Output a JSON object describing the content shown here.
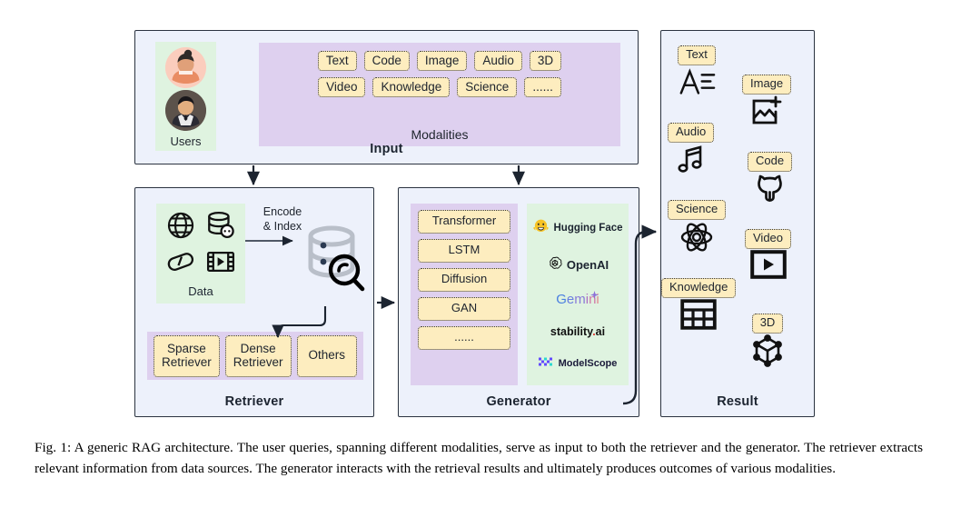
{
  "input": {
    "title": "Input",
    "users_label": "Users",
    "modalities_label": "Modalities",
    "modalities_row1": [
      "Text",
      "Code",
      "Image",
      "Audio",
      "3D"
    ],
    "modalities_row2": [
      "Video",
      "Knowledge",
      "Science",
      "......"
    ]
  },
  "retriever": {
    "title": "Retriever",
    "data_label": "Data",
    "data_icons": [
      "globe-icon",
      "database-icon",
      "capsule-icon",
      "film-icon"
    ],
    "encode_label": "Encode\n& Index",
    "encode_line1": "Encode",
    "encode_line2": "& Index",
    "retrievers": [
      "Sparse Retriever",
      "Dense Retriever",
      "Others"
    ],
    "retriever_lines": [
      [
        "Sparse",
        "Retriever"
      ],
      [
        "Dense",
        "Retriever"
      ],
      [
        "Others",
        ""
      ]
    ]
  },
  "generator": {
    "title": "Generator",
    "architectures": [
      "Transformer",
      "LSTM",
      "Diffusion",
      "GAN",
      "......"
    ],
    "logos": [
      {
        "name": "Hugging Face",
        "icon": "hugging-face-icon"
      },
      {
        "name": "OpenAI",
        "icon": "openai-icon"
      },
      {
        "name": "Gemini",
        "icon": "gemini-sparkle-icon"
      },
      {
        "name": "stability.ai",
        "icon": "stability-icon"
      },
      {
        "name": "ModelScope",
        "icon": "modelscope-icon"
      }
    ]
  },
  "result": {
    "title": "Result",
    "items": [
      {
        "label": "Text",
        "icon": "text-a-lines-icon"
      },
      {
        "label": "Image",
        "icon": "image-plus-icon"
      },
      {
        "label": "Audio",
        "icon": "music-note-icon"
      },
      {
        "label": "Code",
        "icon": "github-cat-icon"
      },
      {
        "label": "Science",
        "icon": "atom-icon"
      },
      {
        "label": "Video",
        "icon": "play-box-icon"
      },
      {
        "label": "Knowledge",
        "icon": "table-grid-icon"
      },
      {
        "label": "3D",
        "icon": "cube-icon"
      }
    ]
  },
  "caption": "Fig. 1: A generic RAG architecture. The user queries, spanning different modalities, serve as input to both the retriever and the generator. The retriever extracts relevant information from data sources. The generator interacts with the retrieval results and ultimately produces outcomes of various modalities.",
  "colors": {
    "panel_bg": "#edf1fb",
    "panel_border": "#2b3340",
    "chip_bg": "#fdedbf",
    "green_bg": "#dff3e0",
    "purple_bg": "#ded0ef",
    "arrow": "#1c2430"
  }
}
